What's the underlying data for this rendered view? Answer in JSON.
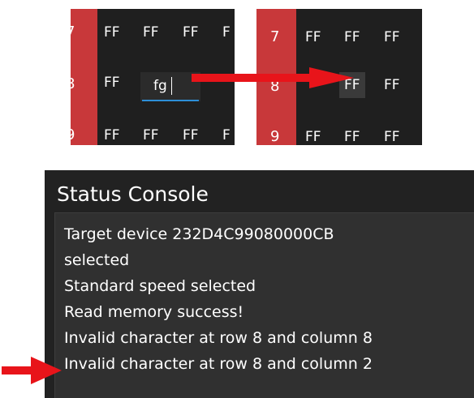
{
  "hex_grid_before": {
    "rows": [
      {
        "row": "7",
        "cells": [
          "FF",
          "FF",
          "FF",
          "F"
        ]
      },
      {
        "row": "8",
        "cells": [
          "FF",
          "",
          "",
          ""
        ]
      },
      {
        "row": "9",
        "cells": [
          "FF",
          "FF",
          "FF",
          "F"
        ]
      }
    ],
    "edit_value": "fg"
  },
  "hex_grid_after": {
    "rows": [
      {
        "row": "7",
        "cells": [
          "FF",
          "FF",
          "FF"
        ]
      },
      {
        "row": "8",
        "cells": [
          "",
          "FF",
          "FF"
        ]
      },
      {
        "row": "9",
        "cells": [
          "FF",
          "FF",
          "FF"
        ]
      }
    ],
    "hidden_row_label": "8"
  },
  "status_console": {
    "title": "Status Console",
    "lines": [
      "Target device 232D4C99080000CB",
      "selected",
      "Standard speed selected",
      "Read memory success!",
      "Invalid character at row 8 and column 8",
      "Invalid character at row 8 and column 2"
    ]
  },
  "colors": {
    "row_gutter": "#c8383a",
    "grid_bg": "#1f1f1f",
    "console_bg": "#222222",
    "console_box_bg": "#303030",
    "arrow": "#e8141a",
    "edit_underline": "#2d8fd8"
  },
  "icons": {
    "callout_arrow_right": "arrow-right-icon",
    "callout_arrow_small": "arrow-right-icon"
  }
}
